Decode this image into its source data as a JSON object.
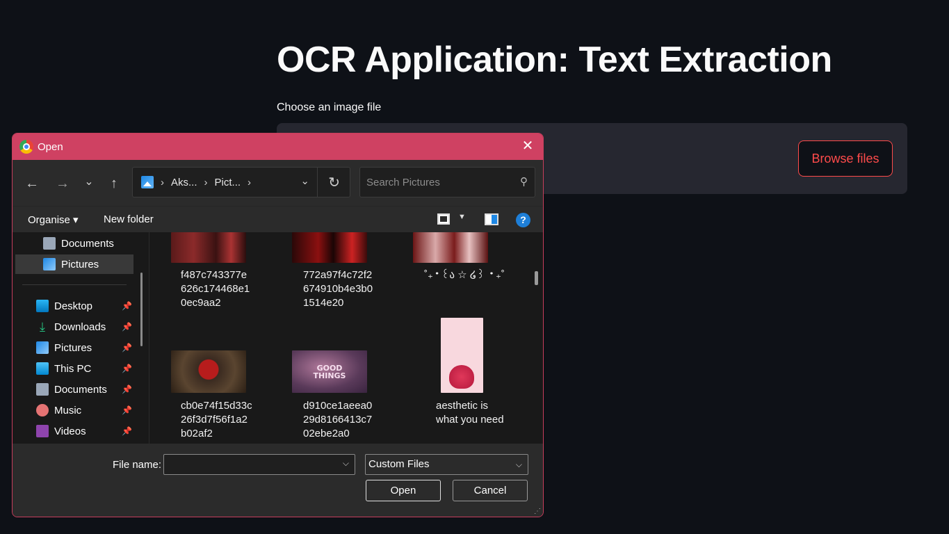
{
  "app": {
    "title": "OCR Application: Text Extraction",
    "uploader_label": "Choose an image file",
    "browse_label": "Browse files"
  },
  "dialog": {
    "title": "Open",
    "close_glyph": "✕",
    "nav": {
      "back": "←",
      "forward": "→",
      "recent": "⌄",
      "up": "↑"
    },
    "breadcrumb": [
      "Aks...",
      "Pict..."
    ],
    "refresh_glyph": "↻",
    "search_placeholder": "Search Pictures",
    "commands": {
      "organise": "Organise ▾",
      "new_folder": "New folder",
      "help": "?"
    },
    "sidebar": {
      "top_items": [
        {
          "label": "Documents",
          "icon": "documents-icon"
        },
        {
          "label": "Pictures",
          "icon": "pictures-icon",
          "selected": true
        }
      ],
      "quick_access": [
        {
          "label": "Desktop",
          "icon": "desktop-icon",
          "pinned": true
        },
        {
          "label": "Downloads",
          "icon": "downloads-icon",
          "pinned": true
        },
        {
          "label": "Pictures",
          "icon": "pictures-icon",
          "pinned": true
        },
        {
          "label": "This PC",
          "icon": "this-pc-icon",
          "pinned": true
        },
        {
          "label": "Documents",
          "icon": "documents-icon",
          "pinned": true
        },
        {
          "label": "Music",
          "icon": "music-icon",
          "pinned": true
        },
        {
          "label": "Videos",
          "icon": "videos-icon",
          "pinned": true
        }
      ]
    },
    "files": [
      {
        "name": "f487c743377e\n626c174468e1\n0ec9aa2"
      },
      {
        "name": "772a97f4c72f2\n674910b4e3b0\n1514e20"
      },
      {
        "name": "˚₊‧꒰ა ☆ ໒꒱ ‧₊˚"
      },
      {
        "name": "cb0e74f15d33c\n26f3d7f56f1a2\nb02af2"
      },
      {
        "name": "d910ce1aeea0\n29d8166413c7\n02ebe2a0",
        "thumb_text": "GOOD THINGS"
      },
      {
        "name": "aesthetic is\nwhat you need"
      }
    ],
    "footer": {
      "file_name_label": "File name:",
      "file_name_value": "",
      "file_type": "Custom Files",
      "open_label": "Open",
      "cancel_label": "Cancel"
    }
  },
  "colors": {
    "accent": "#ff4b4b",
    "dialog_titlebar": "#cf4162",
    "app_bg": "#0e1117"
  }
}
